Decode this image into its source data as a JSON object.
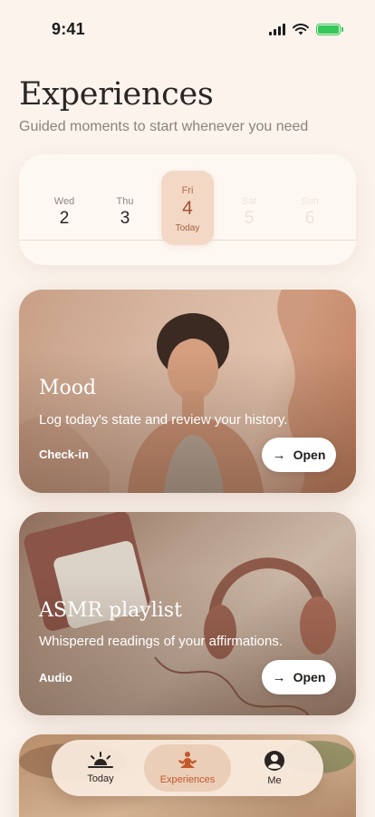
{
  "status_bar": {
    "time": "9:41"
  },
  "header": {
    "title": "Experiences",
    "subtitle": "Guided moments to start whenever you need"
  },
  "week": {
    "days": [
      {
        "name": "Wed",
        "num": "2"
      },
      {
        "name": "Thu",
        "num": "3"
      },
      {
        "name": "Fri",
        "num": "4",
        "today_label": "Today",
        "active": true
      },
      {
        "name": "Sat",
        "num": "5"
      },
      {
        "name": "Sun",
        "num": "6"
      }
    ]
  },
  "cards": [
    {
      "title": "Mood",
      "description": "Log today's state and review your history.",
      "tag": "Check-in",
      "button": "Open"
    },
    {
      "title": "ASMR playlist",
      "description": "Whispered readings of your affirmations.",
      "tag": "Audio",
      "button": "Open"
    }
  ],
  "tab_bar": {
    "tabs": [
      {
        "label": "Today",
        "icon": "sunrise-icon"
      },
      {
        "label": "Experiences",
        "icon": "meditation-icon",
        "active": true
      },
      {
        "label": "Me",
        "icon": "person-icon"
      }
    ]
  },
  "colors": {
    "background": "#fbf3ec",
    "accent": "#c2582c",
    "active_day_bg": "#f3d8c6",
    "battery": "#35c759"
  }
}
